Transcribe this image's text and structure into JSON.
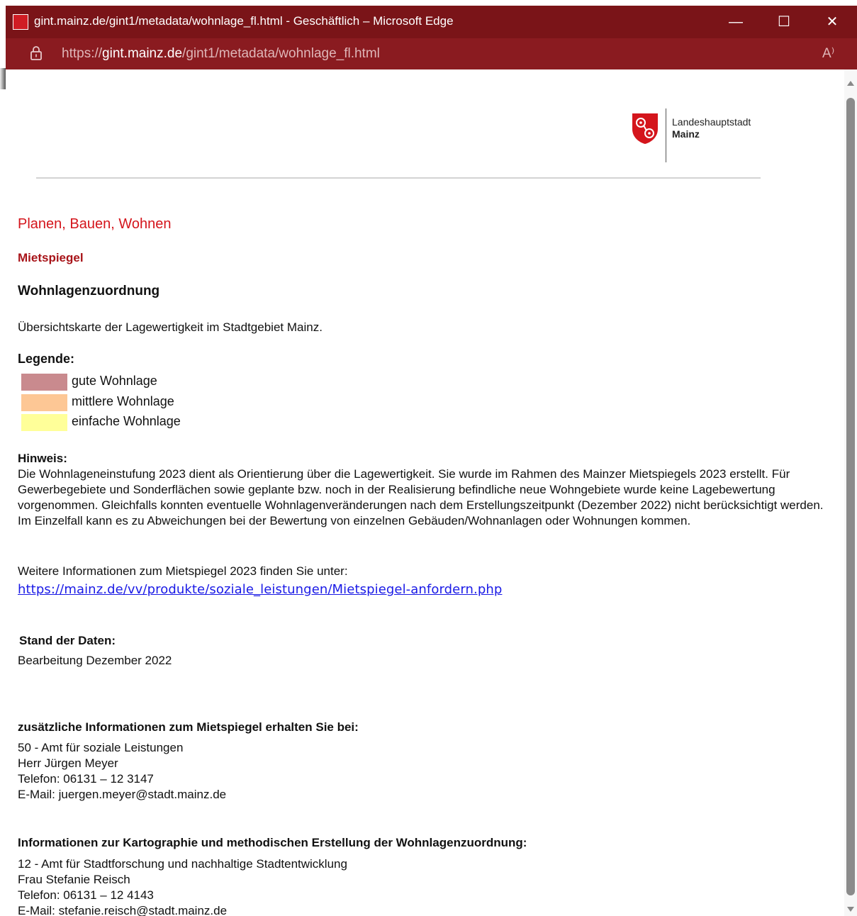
{
  "window": {
    "title": "gint.mainz.de/gint1/metadata/wohnlage_fl.html - Geschäftlich – Microsoft Edge",
    "url_prefix": "https://",
    "url_host": "gint.mainz.de",
    "url_path": "/gint1/metadata/wohnlage_fl.html",
    "minimize_glyph": "—",
    "maximize_glyph": "☐",
    "close_glyph": "✕",
    "read_aloud_glyph": "A⁾",
    "accent_color": "#7a1418"
  },
  "logo": {
    "line1": "Landeshauptstadt",
    "line2": "Mainz",
    "shield_color": "#d4151c"
  },
  "page": {
    "heading1": "Planen, Bauen, Wohnen",
    "heading2": "Mietspiegel",
    "heading3": "Wohnlagenzuordnung",
    "intro": "Übersichtskarte der Lagewertigkeit im Stadtgebiet Mainz.",
    "legend_title": "Legende:",
    "legend": [
      {
        "label": "gute Wohnlage",
        "color": "#c98a8e"
      },
      {
        "label": "mittlere Wohnlage",
        "color": "#fdc795"
      },
      {
        "label": "einfache Wohnlage",
        "color": "#ffff99"
      }
    ],
    "hint_title": "Hinweis:",
    "hint_text": "Die Wohnlageneinstufung 2023 dient als Orientierung über die Lagewertigkeit. Sie wurde im Rahmen des Mainzer Mietspiegels 2023 erstellt. Für Gewerbegebiete und Sonderflächen sowie geplante bzw. noch in der Realisierung befindliche neue Wohngebiete wurde keine Lagebewertung vorgenommen. Gleichfalls konnten eventuelle Wohnlagenveränderungen nach dem Erstellungszeitpunkt (Dezember 2022) nicht berücksichtigt werden. Im Einzelfall kann es zu Abweichungen bei der Bewertung von einzelnen Gebäuden/Wohnanlagen oder Wohnungen kommen.",
    "more_info": "Weitere Informationen zum Mietspiegel 2023 finden Sie unter:",
    "link": "https://mainz.de/vv/produkte/soziale_leistungen/Mietspiegel-anfordern.php",
    "stand_title": "Stand der Daten:",
    "stand_text": "Bearbeitung Dezember 2022",
    "contact1_title": "zusätzliche Informationen zum Mietspiegel erhalten Sie bei:",
    "contact1_lines": [
      "50 - Amt für soziale Leistungen",
      "Herr Jürgen Meyer",
      "Telefon: 06131 – 12 3147",
      "E-Mail: juergen.meyer@stadt.mainz.de"
    ],
    "contact2_title": "Informationen zur Kartographie und methodischen Erstellung der Wohnlagenzuordnung:",
    "contact2_lines": [
      "12 - Amt für Stadtforschung und nachhaltige Stadtentwicklung",
      "Frau Stefanie Reisch",
      "Telefon: 06131 – 12 4143",
      "E-Mail: stefanie.reisch@stadt.mainz.de"
    ]
  }
}
